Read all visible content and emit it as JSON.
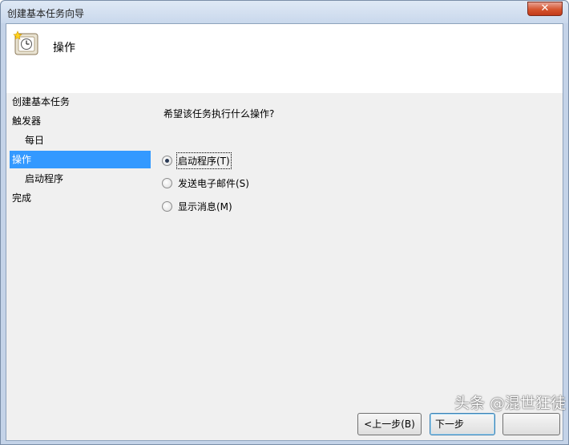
{
  "window": {
    "title": "创建基本任务向导",
    "close_label": "✕"
  },
  "header": {
    "title": "操作",
    "icon": "clock-task-icon"
  },
  "nav": {
    "items": [
      {
        "label": "创建基本任务"
      },
      {
        "label": "触发器"
      },
      {
        "label": "每日"
      },
      {
        "label": "操作"
      },
      {
        "label": "启动程序"
      },
      {
        "label": "完成"
      }
    ]
  },
  "main": {
    "question": "希望该任务执行什么操作?",
    "options": [
      {
        "label": "启动程序(T)",
        "selected": true
      },
      {
        "label": "发送电子邮件(S)",
        "selected": false
      },
      {
        "label": "显示消息(M)",
        "selected": false
      }
    ]
  },
  "buttons": {
    "back_label": "<上一步(B)",
    "next_label": "下一步"
  },
  "watermark": "头条 @混世狂徒",
  "colors": {
    "selection": "#3399ff",
    "close": "#d5552f"
  }
}
